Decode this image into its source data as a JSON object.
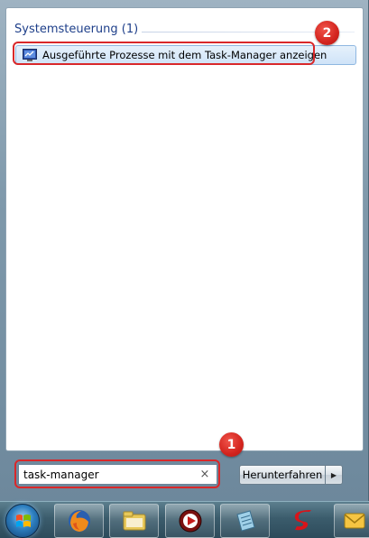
{
  "results": {
    "section_title": "Systemsteuerung (1)",
    "items": [
      {
        "label": "Ausgeführte Prozesse mit dem Task-Manager anzeigen",
        "icon": "task-manager-icon"
      }
    ]
  },
  "search": {
    "value": "task-manager",
    "clear_icon": "×"
  },
  "shutdown": {
    "label": "Herunterfahren",
    "arrow_icon": "▶"
  },
  "annotations": {
    "badge_1": "1",
    "badge_2": "2"
  },
  "taskbar": {
    "apps": [
      "firefox-icon",
      "explorer-icon",
      "media-player-icon",
      "notepad-icon",
      "s-app-icon",
      "mail-icon"
    ]
  },
  "colors": {
    "header_text": "#1e3f8a",
    "highlight_red": "#d9282a",
    "selection_bg": "#cfe3f8"
  }
}
